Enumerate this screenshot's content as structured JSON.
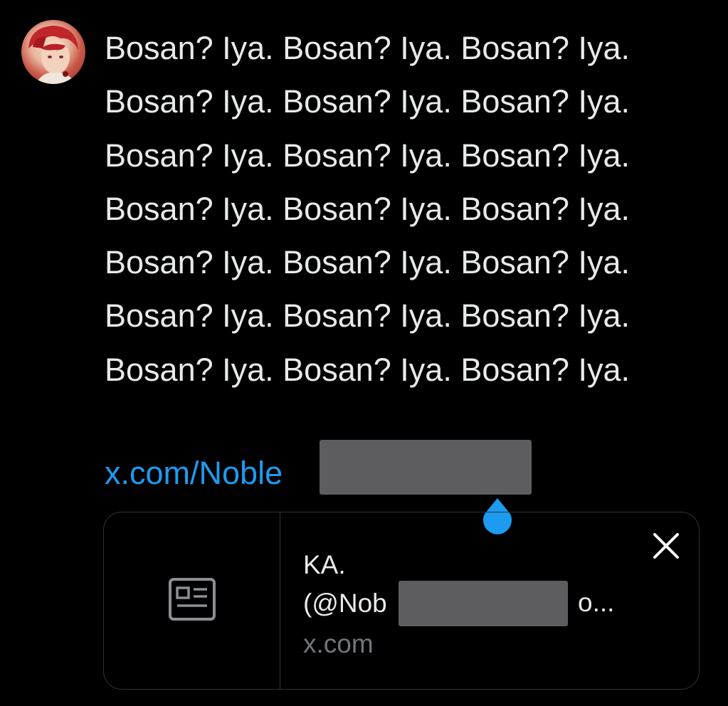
{
  "tweet": {
    "lines": [
      "Bosan? Iya. Bosan? Iya. Bosan? Iya.",
      "Bosan? Iya. Bosan? Iya. Bosan? Iya.",
      "Bosan? Iya. Bosan? Iya. Bosan? Iya.",
      "Bosan? Iya. Bosan? Iya. Bosan? Iya.",
      "Bosan? Iya. Bosan? Iya. Bosan? Iya.",
      "Bosan? Iya. Bosan? Iya. Bosan? Iya.",
      "Bosan? Iya. Bosan? Iya. Bosan? Iya."
    ],
    "link_text": "x.com/Noble"
  },
  "link_card": {
    "title": "KA.",
    "handle_prefix": "(@Nob",
    "handle_suffix": "o...",
    "domain": "x.com",
    "thumbnail_icon": "article-icon",
    "close_icon": "close-icon"
  },
  "colors": {
    "background": "#000000",
    "text": "#e7e9ea",
    "link": "#1d9bf0",
    "muted": "#71767b",
    "border": "#2f3336",
    "redaction": "#5d5d5f"
  }
}
